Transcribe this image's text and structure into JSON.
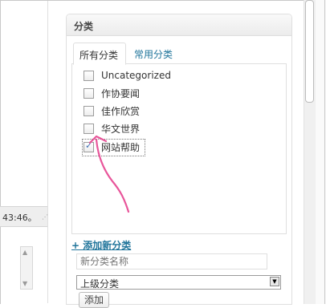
{
  "left_panel": {
    "status_text": "43:46。"
  },
  "categories_box": {
    "title": "分类",
    "tabs": {
      "all": "所有分类",
      "popular": "常用分类"
    },
    "items": [
      {
        "label": "Uncategorized",
        "checked": false
      },
      {
        "label": "作协要闻",
        "checked": false
      },
      {
        "label": "佳作欣赏",
        "checked": false
      },
      {
        "label": "华文世界",
        "checked": false
      },
      {
        "label": "网站帮助",
        "checked": true
      }
    ],
    "add_new_link": "+ 添加新分类",
    "new_category_placeholder": "新分类名称",
    "parent_select_value": "上级分类",
    "add_button": "添加"
  },
  "colors": {
    "link": "#21759b",
    "annotation_arrow": "#e8559a"
  },
  "icons": {
    "checkbox": "checkbox-icon",
    "dropdown": "dropdown-arrow-icon",
    "resize": "resize-grip-icon",
    "annotation": "pink-arrow-annotation"
  }
}
